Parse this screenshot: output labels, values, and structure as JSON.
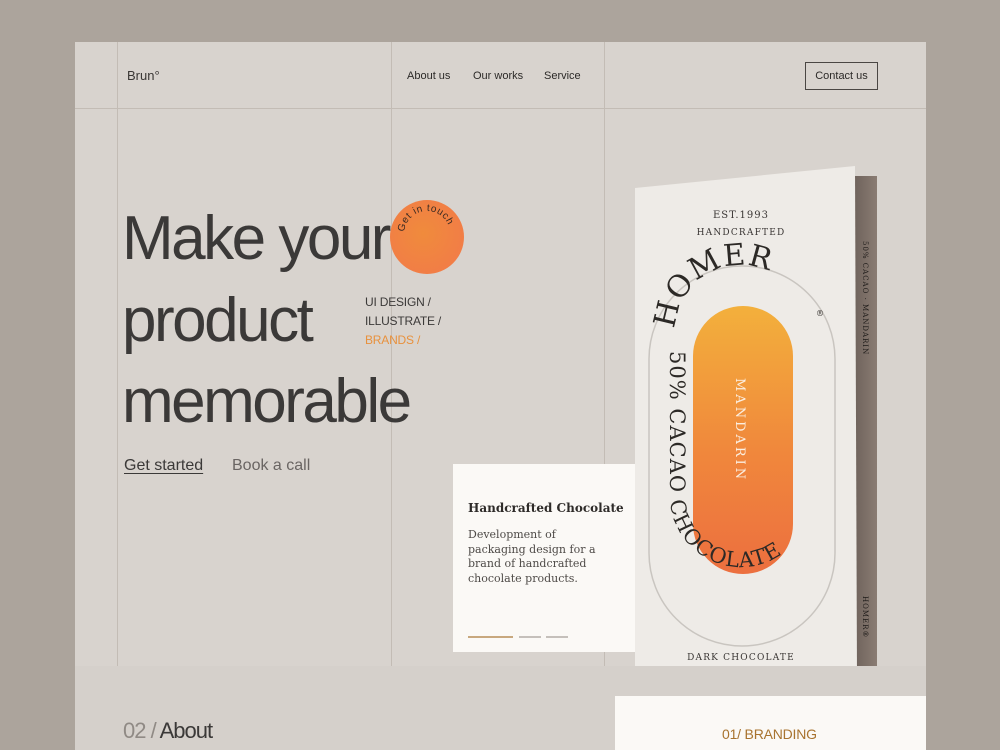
{
  "brand": {
    "logo": "Brun°"
  },
  "nav": {
    "items": [
      {
        "label": "About us"
      },
      {
        "label": "Our works"
      },
      {
        "label": "Service"
      }
    ],
    "contact_label": "Contact us"
  },
  "hero": {
    "lines": [
      "Make your",
      "product",
      "memorable"
    ],
    "badge_text": "Get in touch",
    "tags": [
      "UI DESIGN /",
      "ILLUSTRATE /",
      "BRANDS /"
    ],
    "cta_primary": "Get started",
    "cta_secondary": "Book a call"
  },
  "card": {
    "title": "Handcrafted Chocolate",
    "description": "Development of packaging design for a brand of handcrafted chocolate products.",
    "pagination_count": 3
  },
  "package": {
    "est": "EST.1993",
    "handcrafted": "HANDCRAFTED",
    "brand_name": "HOMER",
    "registered": "®",
    "ring_text": "50% CACAO CHOCOLATE",
    "flavor": "MANDARIN",
    "bottom_label": "DARK CHOCOLATE",
    "side_text_top": "50% CACAO · MANDARIN",
    "side_text_bottom": "HOMER®"
  },
  "about": {
    "number": "02 /",
    "title": "About"
  },
  "branding": {
    "label": "01/ BRANDING"
  },
  "colors": {
    "accent": "#e8913d",
    "page_bg": "#d8d3ce",
    "outer_bg": "#aca49c",
    "card_bg": "#fbf9f6"
  }
}
